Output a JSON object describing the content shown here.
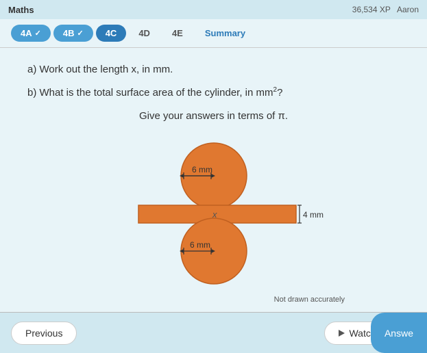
{
  "topbar": {
    "subject": "Maths",
    "xp": "36,534 XP",
    "user": "Aaron"
  },
  "tabs": [
    {
      "id": "4A",
      "label": "4A",
      "state": "completed"
    },
    {
      "id": "4B",
      "label": "4B",
      "state": "completed"
    },
    {
      "id": "4C",
      "label": "4C",
      "state": "active"
    },
    {
      "id": "4D",
      "label": "4D",
      "state": "inactive"
    },
    {
      "id": "4E",
      "label": "4E",
      "state": "inactive"
    },
    {
      "id": "summary",
      "label": "Summary",
      "state": "summary"
    }
  ],
  "questions": {
    "a": "a) Work out the length x, in mm.",
    "b": "b) What is the total surface area of the cylinder, in mm",
    "b_sup": "2",
    "b_end": "?",
    "instruction": "Give your answers in terms of π."
  },
  "diagram": {
    "radius_label": "6 mm",
    "radius_label2": "6 mm",
    "x_label": "x",
    "height_label": "4 mm"
  },
  "not_drawn": "Not drawn accurately",
  "buttons": {
    "previous": "Previous",
    "watch_video": "Watch video",
    "answer": "Answe"
  }
}
